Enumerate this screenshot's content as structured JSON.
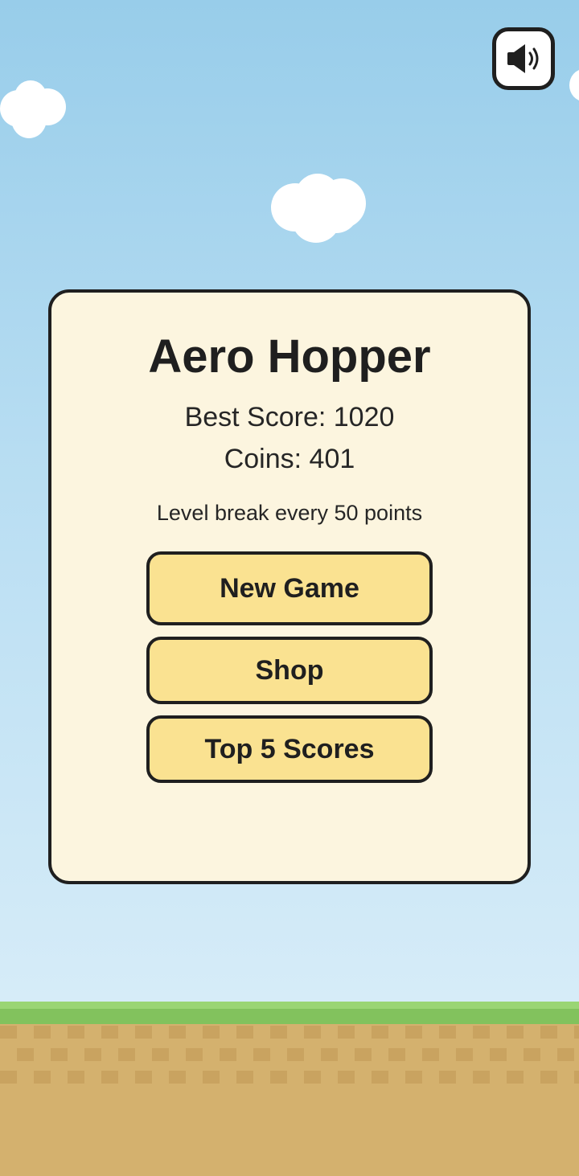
{
  "game": {
    "title": "Aero Hopper",
    "best_score_label": "Best Score: 1020",
    "coins_label": "Coins: 401",
    "level_info": "Level break every 50 points"
  },
  "buttons": {
    "new_game": "New Game",
    "shop": "Shop",
    "top_scores": "Top 5 Scores"
  },
  "icons": {
    "sound": "speaker-volume-icon",
    "clouds": "cloud-icon"
  },
  "colors": {
    "sky_top": "#98CDEA",
    "sky_bottom": "#D6ECF8",
    "panel_bg": "#FCF5DF",
    "button_bg": "#FAE291",
    "outline": "#1F1F1F",
    "grass": "#82C25D",
    "dirt": "#D4B16E"
  }
}
